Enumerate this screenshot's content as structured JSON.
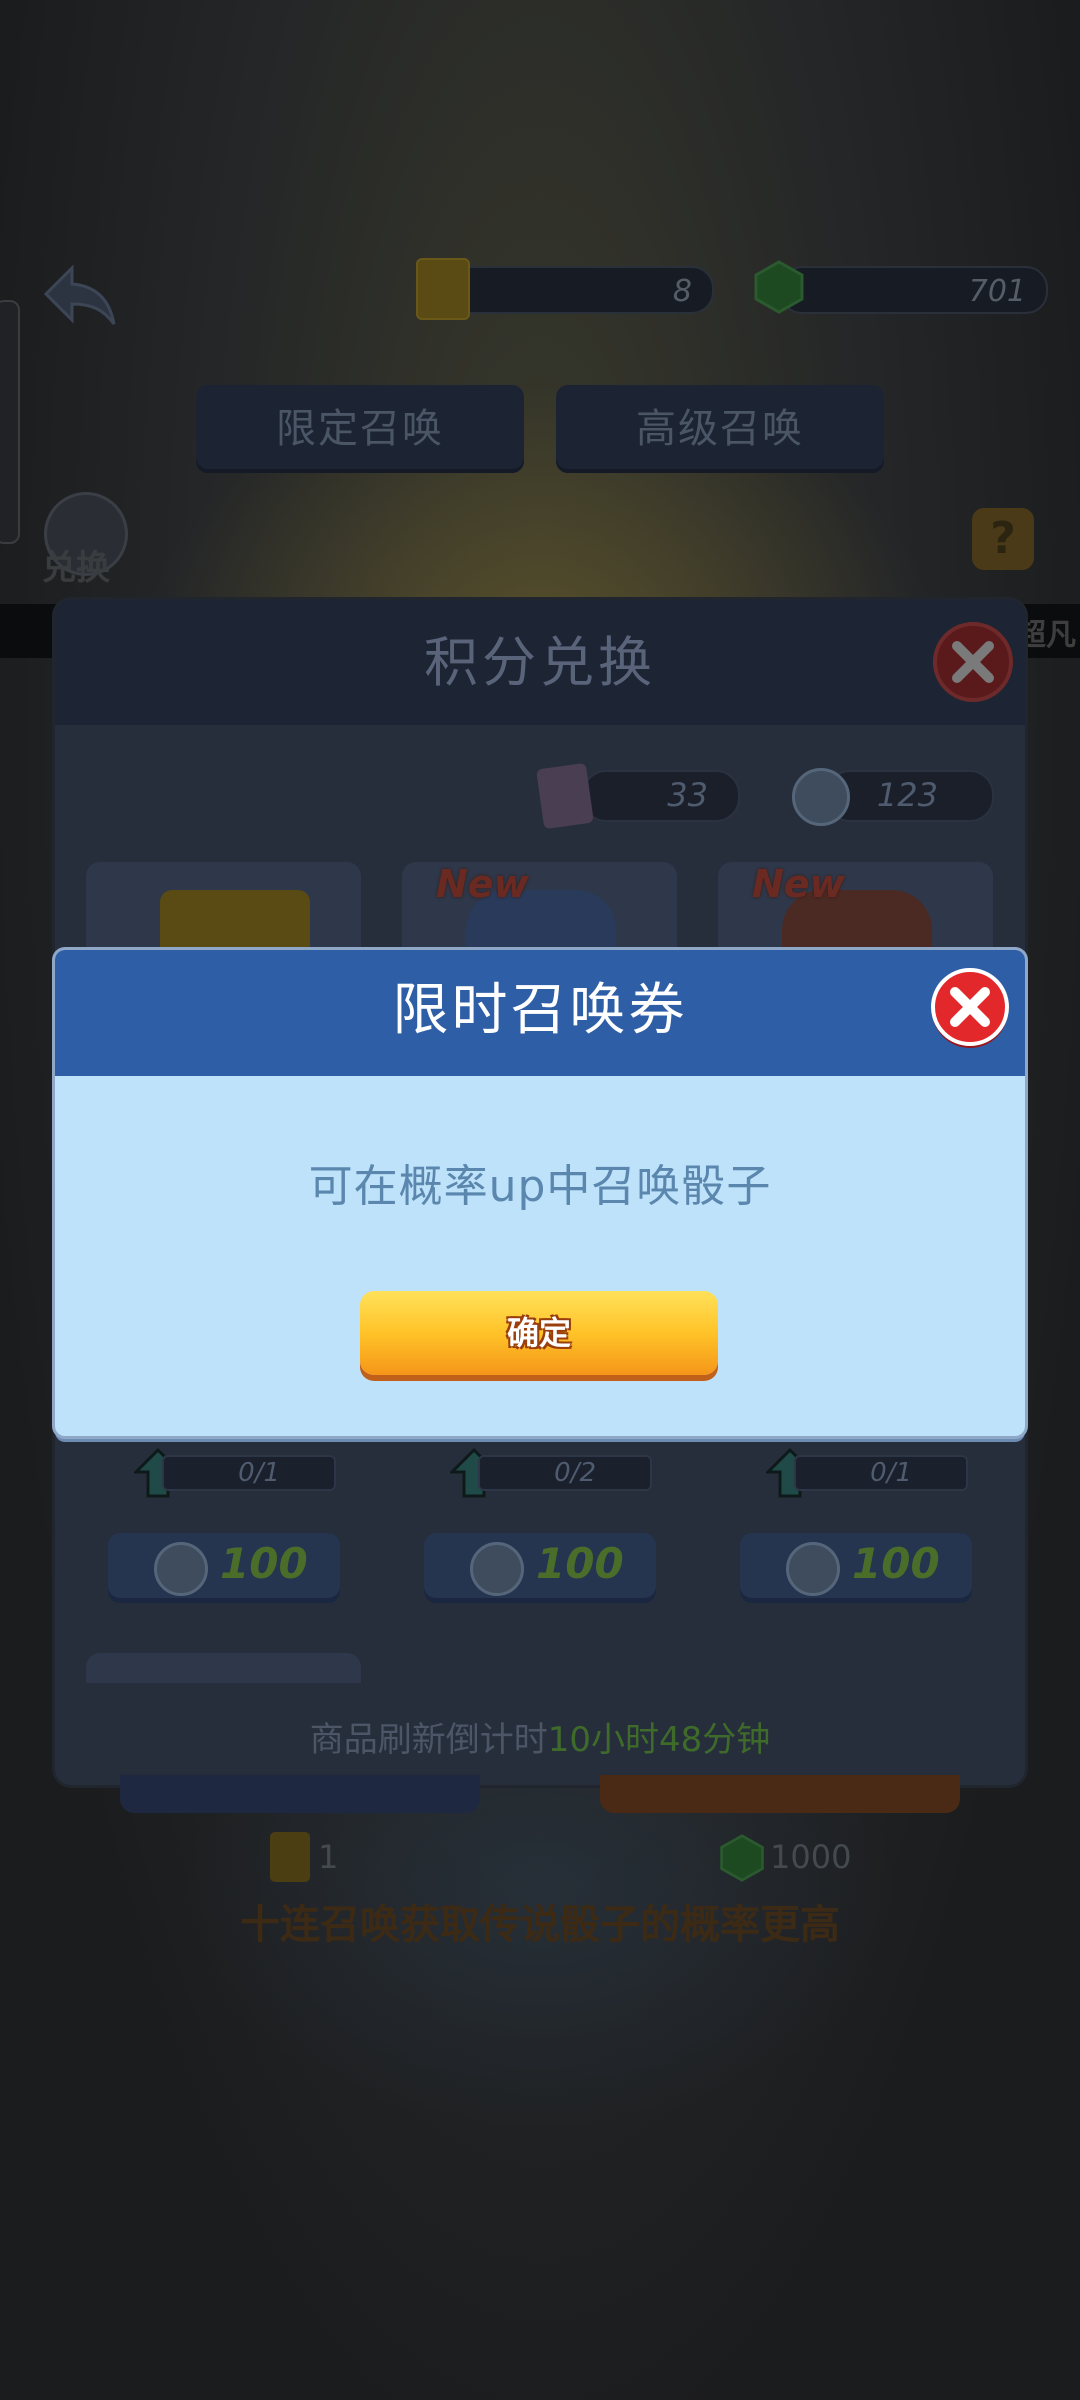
{
  "header": {
    "tickets_count": "8",
    "gems_count": "701",
    "tabs": [
      "限定召唤",
      "高级召唤"
    ],
    "exchange_label": "兑换",
    "help_symbol": "?",
    "strip_label": "超凡"
  },
  "exchange_panel": {
    "title": "积分兑换",
    "currency": [
      "33",
      "123"
    ],
    "new_badge": "New",
    "items": [
      {
        "progress": "0/1",
        "price": "100"
      },
      {
        "progress": "0/2",
        "price": "100"
      },
      {
        "progress": "0/1",
        "price": "100"
      }
    ],
    "refresh_label": "商品刷新倒计时",
    "refresh_time": "10小时48分钟"
  },
  "summon_costs": [
    "1",
    "1000"
  ],
  "promo_text": "十连召唤获取传说骰子的概率更高",
  "dialog": {
    "title": "限时召唤券",
    "message": "可在概率up中召唤骰子",
    "confirm": "确定"
  },
  "colors": {
    "dialog_header": "#2d5ea6",
    "dialog_body": "#bde2fa",
    "close_red": "#d9262a",
    "confirm_orange": "#ffc328"
  }
}
